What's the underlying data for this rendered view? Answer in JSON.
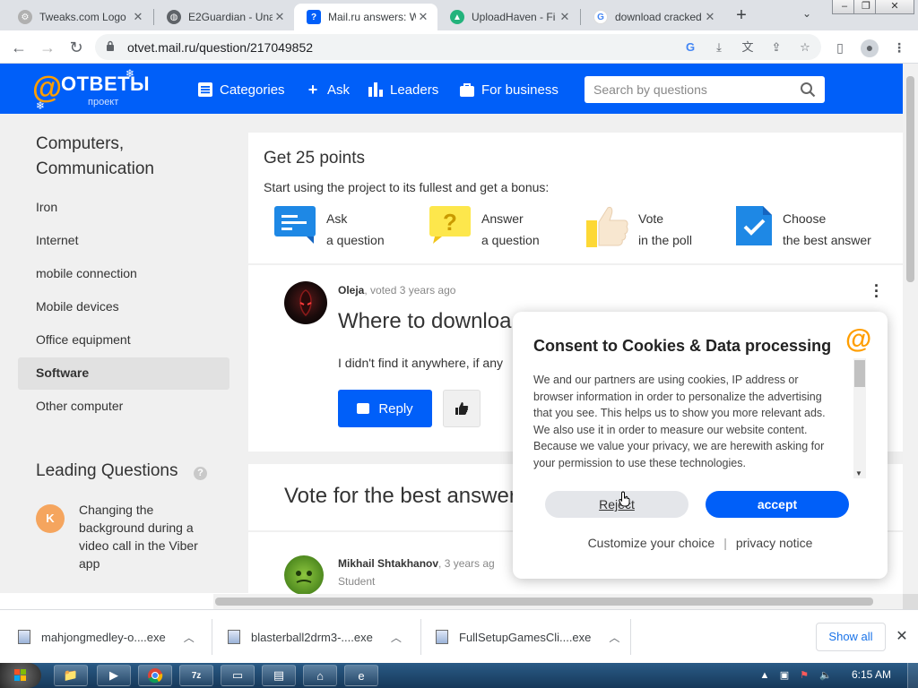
{
  "browser": {
    "tabs": [
      {
        "title": "Tweaks.com Logo",
        "favicon_color": "#9e9e9e",
        "active": false
      },
      {
        "title": "E2Guardian - Una",
        "favicon_color": "#5f6368",
        "active": false
      },
      {
        "title": "Mail.ru answers: W",
        "favicon_color": "#005ff9",
        "active": true
      },
      {
        "title": "UploadHaven - Fi",
        "favicon_color": "#23b37c",
        "active": false
      },
      {
        "title": "download cracked",
        "favicon_color": "#4285f4",
        "active": false
      }
    ],
    "url": "otvet.mail.ru/question/217049852"
  },
  "site": {
    "logo_text": "ОТВЕТЫ",
    "logo_sub": "проект",
    "nav": [
      {
        "label": "Categories",
        "icon": "grid-list-icon"
      },
      {
        "label": "Ask",
        "icon": "plus-icon"
      },
      {
        "label": "Leaders",
        "icon": "bar-chart-icon"
      },
      {
        "label": "For business",
        "icon": "briefcase-icon"
      }
    ],
    "search_placeholder": "Search by questions"
  },
  "sidebar": {
    "title": "Computers, Communication",
    "items": [
      "Iron",
      "Internet",
      "mobile connection",
      "Mobile devices",
      "Office equipment",
      "Software",
      "Other computer"
    ],
    "active_item": "Software",
    "leading_title": "Leading Questions",
    "leading_question": {
      "avatar_letter": "K",
      "text": "Changing the background during a video call in the Viber app"
    }
  },
  "bonus": {
    "title": "Get 25 points",
    "subtitle": "Start using the project to its fullest and get a bonus:",
    "items": [
      {
        "line1": "Ask",
        "line2": "a question",
        "icon": "chat-bubble-icon"
      },
      {
        "line1": "Answer",
        "line2": "a question",
        "icon": "question-bubble-icon"
      },
      {
        "line1": "Vote",
        "line2": "in the poll",
        "icon": "thumbs-up-icon"
      },
      {
        "line1": "Choose",
        "line2": "the best answer",
        "icon": "check-badge-icon"
      }
    ]
  },
  "question": {
    "author": "Oleja",
    "meta": ", voted 3 years ago",
    "title": "Where to downloa",
    "text": "I didn't find it anywhere, if any",
    "reply_label": "Reply"
  },
  "vote_section": {
    "title": "Vote for the best answer"
  },
  "answer": {
    "author": "Mikhail Shtakhanov",
    "meta": ", 3 years ag",
    "rank": "Student"
  },
  "cookie_modal": {
    "title": "Consent to Cookies & Data processing",
    "body": "We and our partners are using cookies, IP address or browser information in order to personalize the advertising that you see. This helps us to show you more relevant ads. We also use it in order to measure our website content. Because we value your privacy, we are herewith asking for your permission to use these technologies.",
    "reject_label": "Reject",
    "accept_label": "accept",
    "customize_label": "Customize your choice",
    "privacy_label": "privacy notice"
  },
  "downloads": {
    "items": [
      "mahjongmedley-o....exe",
      "blasterball2drm3-....exe",
      "FullSetupGamesCli....exe"
    ],
    "show_all": "Show all"
  },
  "taskbar": {
    "clock": "6:15 AM"
  },
  "colors": {
    "brand_blue": "#005ff9",
    "brand_orange": "#ff9e00"
  }
}
